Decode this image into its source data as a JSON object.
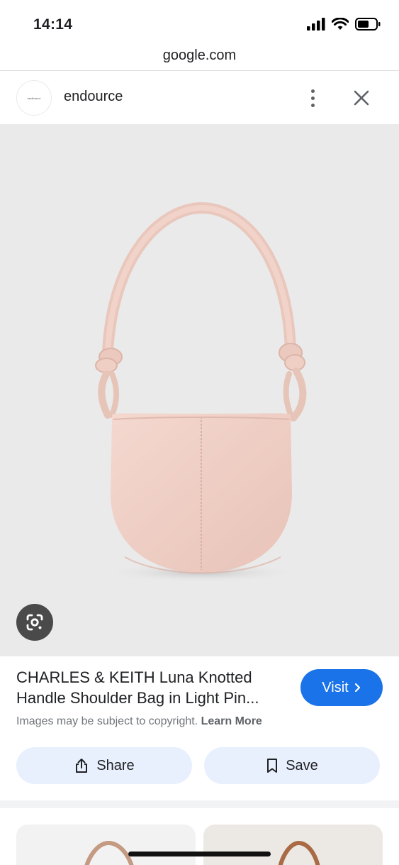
{
  "status_bar": {
    "time": "14:14",
    "icons": [
      "signal-icon",
      "wifi-icon",
      "battery-icon"
    ]
  },
  "browser": {
    "url": "google.com"
  },
  "source": {
    "name": "endource",
    "logo_text": "endource",
    "icons": [
      "more-vert-icon",
      "close-icon"
    ]
  },
  "image": {
    "lens_icon": "google-lens-icon"
  },
  "product": {
    "title": "CHARLES & KEITH Luna Knotted Handle Shoulder Bag in Light Pin...",
    "visit_label": "Visit",
    "copyright_text": "Images may be subject to copyright.",
    "learn_more_label": "Learn More"
  },
  "actions": {
    "share_label": "Share",
    "save_label": "Save"
  },
  "colors": {
    "visit_button": "#1a73e8",
    "action_button_bg": "#e8f0fe",
    "image_bg": "#eaeaea",
    "bag_color": "#efcec4"
  }
}
